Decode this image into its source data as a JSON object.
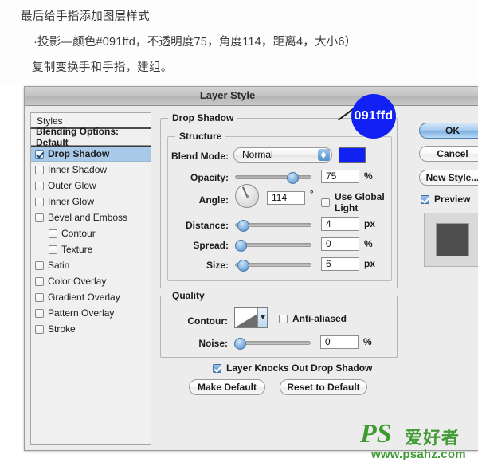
{
  "tutorial": {
    "line1": "最后给手指添加图层样式",
    "line2": "·投影—颜色#091ffd，不透明度75，角度114，距离4，大小6）",
    "line3": "复制变换手和手指，建组。"
  },
  "dialog": {
    "title": "Layer Style",
    "styles_panel": {
      "header": "Styles",
      "items": [
        {
          "label": "Blending Options: Default",
          "checkbox": "none",
          "state": "header"
        },
        {
          "label": "Drop Shadow",
          "checkbox": "checked",
          "state": "selected"
        },
        {
          "label": "Inner Shadow",
          "checkbox": "unchecked",
          "state": "normal"
        },
        {
          "label": "Outer Glow",
          "checkbox": "unchecked",
          "state": "normal"
        },
        {
          "label": "Inner Glow",
          "checkbox": "unchecked",
          "state": "normal"
        },
        {
          "label": "Bevel and Emboss",
          "checkbox": "unchecked",
          "state": "normal"
        },
        {
          "label": "Contour",
          "checkbox": "unchecked",
          "state": "indent"
        },
        {
          "label": "Texture",
          "checkbox": "unchecked",
          "state": "indent"
        },
        {
          "label": "Satin",
          "checkbox": "unchecked",
          "state": "normal"
        },
        {
          "label": "Color Overlay",
          "checkbox": "unchecked",
          "state": "normal"
        },
        {
          "label": "Gradient Overlay",
          "checkbox": "unchecked",
          "state": "normal"
        },
        {
          "label": "Pattern Overlay",
          "checkbox": "unchecked",
          "state": "normal"
        },
        {
          "label": "Stroke",
          "checkbox": "unchecked",
          "state": "normal"
        }
      ]
    },
    "drop_shadow": {
      "group_title": "Drop Shadow",
      "structure": {
        "group_title": "Structure",
        "blend_mode_label": "Blend Mode:",
        "blend_mode_value": "Normal",
        "color_swatch": "#091ffd",
        "opacity_label": "Opacity:",
        "opacity_value": "75",
        "opacity_unit": "%",
        "angle_label": "Angle:",
        "angle_value": "114",
        "angle_unit": "°",
        "use_global_light_label": "Use Global Light",
        "use_global_light_checked": "unchecked",
        "distance_label": "Distance:",
        "distance_value": "4",
        "distance_unit": "px",
        "spread_label": "Spread:",
        "spread_value": "0",
        "spread_unit": "%",
        "size_label": "Size:",
        "size_value": "6",
        "size_unit": "px"
      },
      "quality": {
        "group_title": "Quality",
        "contour_label": "Contour:",
        "anti_aliased_label": "Anti-aliased",
        "anti_aliased_checked": "unchecked",
        "noise_label": "Noise:",
        "noise_value": "0",
        "noise_unit": "%"
      },
      "knockout_label": "Layer Knocks Out Drop Shadow",
      "knockout_checked": "checked",
      "make_default_label": "Make Default",
      "reset_default_label": "Reset to Default"
    },
    "buttons": {
      "ok": "OK",
      "cancel": "Cancel",
      "new_style": "New Style...",
      "preview_label": "Preview",
      "preview_checked": "checked"
    }
  },
  "annotation": {
    "color_code": "091ffd",
    "circle_color": "#1121f3"
  },
  "watermark": {
    "logo": "PS",
    "logo_cn": "爱好者",
    "url": "www.psahz.com",
    "color": "#3f9a34"
  }
}
